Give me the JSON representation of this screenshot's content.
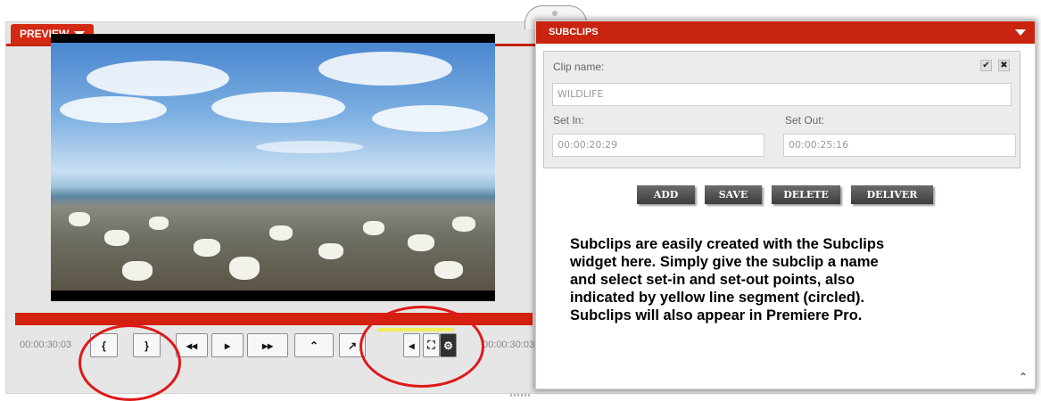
{
  "preview": {
    "tab_label": "PREVIEW",
    "time_current": "00:00:30:03",
    "time_end": "00:00:30:03",
    "controls": {
      "set_in": "{",
      "set_out": "}",
      "rewind": "◂◂",
      "play": "▸",
      "fast_forward": "▸▸",
      "up": "⌃",
      "marker": "↗",
      "volume": "◂",
      "fullscreen": "⛶",
      "settings": "⚙"
    }
  },
  "subclips": {
    "title": "SUBCLIPS",
    "clip_name_label": "Clip name:",
    "clip_name_value": "WILDLIFE",
    "set_in_label": "Set In:",
    "set_in_value": "00:00:20:29",
    "set_out_label": "Set Out:",
    "set_out_value": "00:00:25:16",
    "confirm_glyph": "✔",
    "close_glyph": "✖",
    "buttons": [
      "ADD",
      "SAVE",
      "DELETE",
      "DELIVER"
    ],
    "note": "Subclips are easily created with the Subclips\nwidget here. Simply give the subclip a name\nand select set-in and set-out points, also\nindicated by yellow line segment (circled).\nSubclips will also appear in Premiere Pro.",
    "collapse_glyph": "⌃"
  },
  "colors": {
    "accent": "#d32a12",
    "timeline": "#d4200f",
    "segment": "#f1ef57",
    "annotation_circle": "#e01919"
  }
}
